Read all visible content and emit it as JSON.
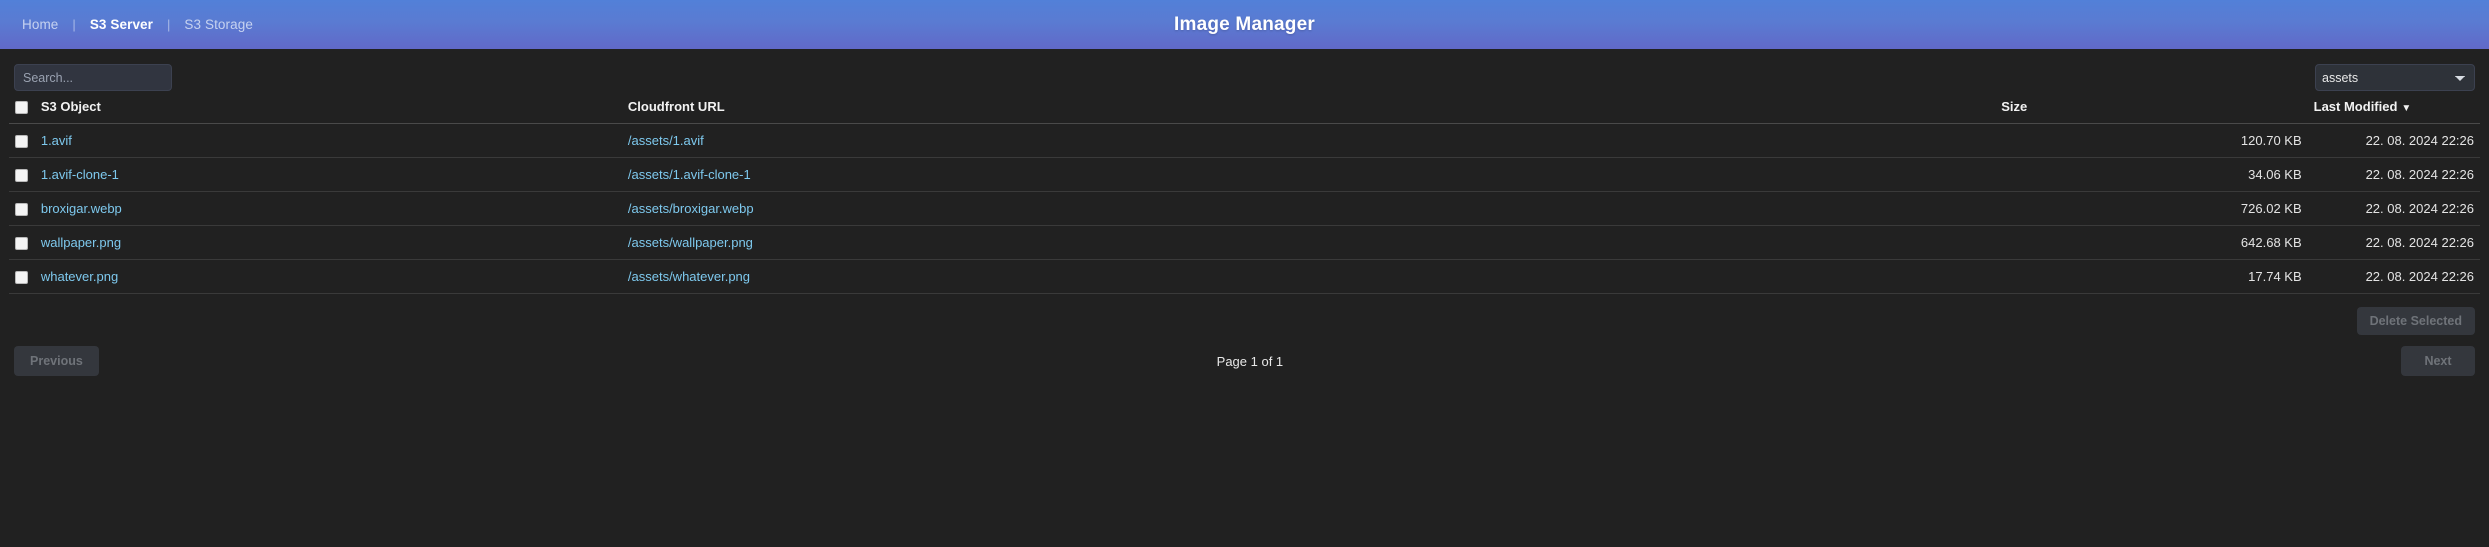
{
  "header": {
    "title": "Image Manager",
    "nav": [
      {
        "label": "Home",
        "active": false
      },
      {
        "label": "S3 Server",
        "active": true
      },
      {
        "label": "S3 Storage",
        "active": false
      }
    ],
    "separator": "|",
    "gradient_from": "#5280d8",
    "gradient_to": "#6169c8"
  },
  "toolbar": {
    "search_value": "",
    "search_placeholder": "Search...",
    "bucket_selected": "assets",
    "bucket_options": [
      "assets"
    ]
  },
  "table": {
    "columns": {
      "object": "S3 Object",
      "url": "Cloudfront URL",
      "size": "Size",
      "modified": "Last Modified",
      "sort_caret": "▼"
    },
    "rows": [
      {
        "name": "1.avif",
        "url": "/assets/1.avif",
        "size": "120.70 KB",
        "modified": "22. 08. 2024 22:26"
      },
      {
        "name": "1.avif-clone-1",
        "url": "/assets/1.avif-clone-1",
        "size": "34.06 KB",
        "modified": "22. 08. 2024 22:26"
      },
      {
        "name": "broxigar.webp",
        "url": "/assets/broxigar.webp",
        "size": "726.02 KB",
        "modified": "22. 08. 2024 22:26"
      },
      {
        "name": "wallpaper.png",
        "url": "/assets/wallpaper.png",
        "size": "642.68 KB",
        "modified": "22. 08. 2024 22:26"
      },
      {
        "name": "whatever.png",
        "url": "/assets/whatever.png",
        "size": "17.74 KB",
        "modified": "22. 08. 2024 22:26"
      }
    ],
    "link_color": "#7ec9ee"
  },
  "actions": {
    "delete_selected": "Delete Selected"
  },
  "pagination": {
    "previous": "Previous",
    "next": "Next",
    "status": "Page 1 of 1"
  }
}
